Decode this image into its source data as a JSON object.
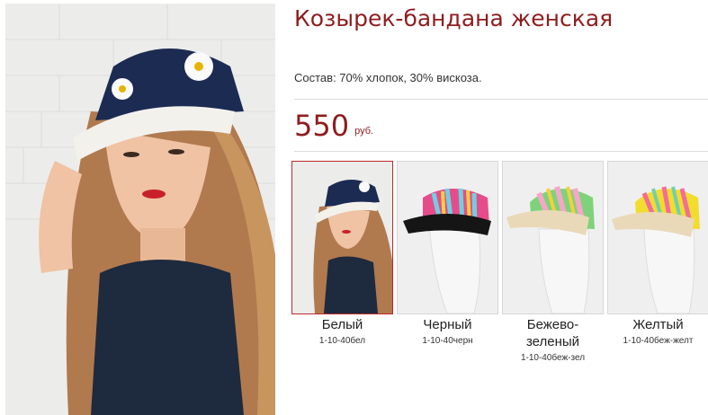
{
  "product": {
    "title": "Козырек-бандана женская",
    "composition": "Состав: 70% хлопок, 30% вискоза.",
    "price": "550",
    "currency": "руб."
  },
  "colors": {
    "accent": "#8e1d1e",
    "active_border": "#c0282d"
  },
  "swatches": [
    {
      "name": "Белый",
      "sku": "1-10-40бел",
      "active": true
    },
    {
      "name": "Черный",
      "sku": "1-10-40черн",
      "active": false
    },
    {
      "name": "Бежево-зеленый",
      "sku": "1-10-40беж-зел",
      "active": false
    },
    {
      "name": "Желтый",
      "sku": "1-10-40беж-желт",
      "active": false
    }
  ]
}
